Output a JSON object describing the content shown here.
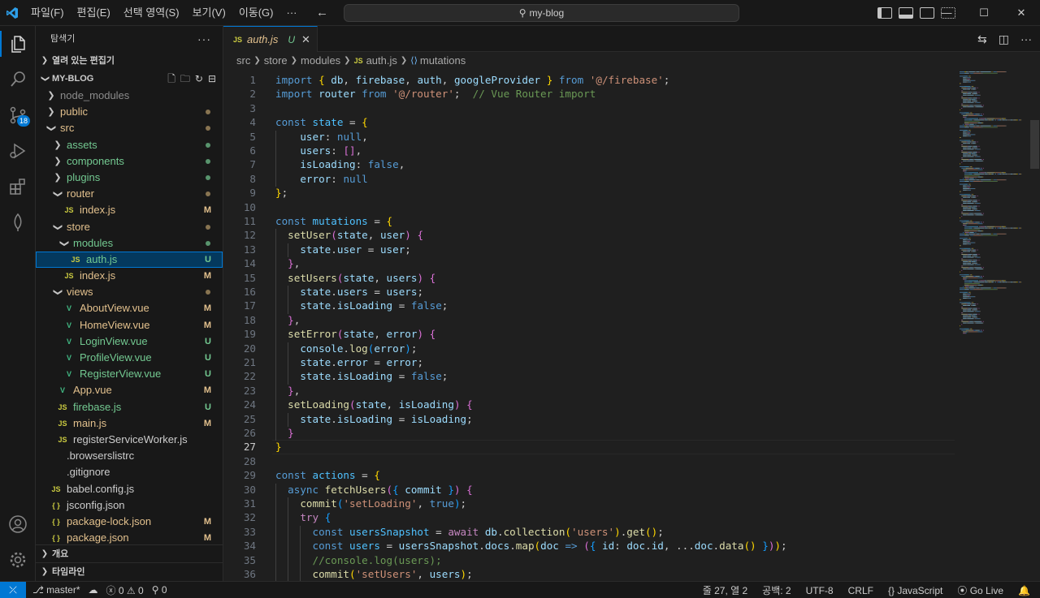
{
  "titlebar": {
    "menu": [
      "파일(F)",
      "편집(E)",
      "선택 영역(S)",
      "보기(V)",
      "이동(G)",
      "···"
    ],
    "search": "my-blog"
  },
  "activity": {
    "scm_badge": "18"
  },
  "sidebar": {
    "title": "탐색기",
    "open_editors": "열려 있는 편집기",
    "project": "MY-BLOG",
    "outline": "개요",
    "timeline": "타임라인",
    "tree": [
      {
        "label": "node_modules",
        "kind": "folder",
        "depth": 1,
        "open": false,
        "color": "ign",
        "status": ""
      },
      {
        "label": "public",
        "kind": "folder",
        "depth": 1,
        "open": false,
        "color": "mod",
        "status": "dot"
      },
      {
        "label": "src",
        "kind": "folder",
        "depth": 1,
        "open": true,
        "color": "mod",
        "status": "dot"
      },
      {
        "label": "assets",
        "kind": "folder",
        "depth": 2,
        "open": false,
        "color": "untr",
        "status": "dot"
      },
      {
        "label": "components",
        "kind": "folder",
        "depth": 2,
        "open": false,
        "color": "untr",
        "status": "dot"
      },
      {
        "label": "plugins",
        "kind": "folder",
        "depth": 2,
        "open": false,
        "color": "untr",
        "status": "dot"
      },
      {
        "label": "router",
        "kind": "folder",
        "depth": 2,
        "open": true,
        "color": "mod",
        "status": "dot"
      },
      {
        "label": "index.js",
        "kind": "js",
        "depth": 3,
        "color": "mod",
        "status": "M"
      },
      {
        "label": "store",
        "kind": "folder",
        "depth": 2,
        "open": true,
        "color": "mod",
        "status": "dot"
      },
      {
        "label": "modules",
        "kind": "folder",
        "depth": 3,
        "open": true,
        "color": "untr",
        "status": "dot"
      },
      {
        "label": "auth.js",
        "kind": "js",
        "depth": 4,
        "color": "untr",
        "status": "U",
        "selected": true
      },
      {
        "label": "index.js",
        "kind": "js",
        "depth": 3,
        "color": "mod",
        "status": "M"
      },
      {
        "label": "views",
        "kind": "folder",
        "depth": 2,
        "open": true,
        "color": "mod",
        "status": "dot"
      },
      {
        "label": "AboutView.vue",
        "kind": "vue",
        "depth": 3,
        "color": "mod",
        "status": "M"
      },
      {
        "label": "HomeView.vue",
        "kind": "vue",
        "depth": 3,
        "color": "mod",
        "status": "M"
      },
      {
        "label": "LoginView.vue",
        "kind": "vue",
        "depth": 3,
        "color": "untr",
        "status": "U"
      },
      {
        "label": "ProfileView.vue",
        "kind": "vue",
        "depth": 3,
        "color": "untr",
        "status": "U"
      },
      {
        "label": "RegisterView.vue",
        "kind": "vue",
        "depth": 3,
        "color": "untr",
        "status": "U"
      },
      {
        "label": "App.vue",
        "kind": "vue",
        "depth": 2,
        "color": "mod",
        "status": "M"
      },
      {
        "label": "firebase.js",
        "kind": "js",
        "depth": 2,
        "color": "untr",
        "status": "U"
      },
      {
        "label": "main.js",
        "kind": "js",
        "depth": 2,
        "color": "mod",
        "status": "M"
      },
      {
        "label": "registerServiceWorker.js",
        "kind": "js",
        "depth": 2,
        "color": "def",
        "status": ""
      },
      {
        "label": ".browserslistrc",
        "kind": "text",
        "depth": 1,
        "color": "def",
        "status": ""
      },
      {
        "label": ".gitignore",
        "kind": "text",
        "depth": 1,
        "color": "def",
        "status": ""
      },
      {
        "label": "babel.config.js",
        "kind": "js",
        "depth": 1,
        "color": "def",
        "status": ""
      },
      {
        "label": "jsconfig.json",
        "kind": "json",
        "depth": 1,
        "color": "def",
        "status": ""
      },
      {
        "label": "package-lock.json",
        "kind": "json",
        "depth": 1,
        "color": "mod",
        "status": "M"
      },
      {
        "label": "package.json",
        "kind": "json",
        "depth": 1,
        "color": "mod",
        "status": "M"
      }
    ]
  },
  "editor": {
    "tab": {
      "label": "auth.js",
      "status": "U",
      "icon": "JS"
    },
    "breadcrumb": [
      "src",
      "store",
      "modules",
      "auth.js",
      "mutations"
    ],
    "current_line": 27,
    "code": [
      [
        [
          "k",
          "import "
        ],
        [
          "b1",
          "{ "
        ],
        [
          "v",
          "db"
        ],
        [
          "p",
          ", "
        ],
        [
          "v",
          "firebase"
        ],
        [
          "p",
          ", "
        ],
        [
          "v",
          "auth"
        ],
        [
          "p",
          ", "
        ],
        [
          "v",
          "googleProvider"
        ],
        [
          "b1",
          " }"
        ],
        [
          "k",
          " from "
        ],
        [
          "s",
          "'@/firebase'"
        ],
        [
          "p",
          ";"
        ]
      ],
      [
        [
          "k",
          "import "
        ],
        [
          "v",
          "router"
        ],
        [
          "k",
          " from "
        ],
        [
          "s",
          "'@/router'"
        ],
        [
          "p",
          ";  "
        ],
        [
          "c",
          "// Vue Router import"
        ]
      ],
      [],
      [
        [
          "k",
          "const "
        ],
        [
          "cn",
          "state"
        ],
        [
          "p",
          " = "
        ],
        [
          "b1",
          "{"
        ]
      ],
      [
        [
          "p",
          "    "
        ],
        [
          "v",
          "user"
        ],
        [
          "p",
          ": "
        ],
        [
          "k",
          "null"
        ],
        [
          "p",
          ","
        ]
      ],
      [
        [
          "p",
          "    "
        ],
        [
          "v",
          "users"
        ],
        [
          "p",
          ": "
        ],
        [
          "b2",
          "[]"
        ],
        [
          "p",
          ","
        ]
      ],
      [
        [
          "p",
          "    "
        ],
        [
          "v",
          "isLoading"
        ],
        [
          "p",
          ": "
        ],
        [
          "k",
          "false"
        ],
        [
          "p",
          ","
        ]
      ],
      [
        [
          "p",
          "    "
        ],
        [
          "v",
          "error"
        ],
        [
          "p",
          ": "
        ],
        [
          "k",
          "null"
        ]
      ],
      [
        [
          "b1",
          "}"
        ],
        [
          "p",
          ";"
        ]
      ],
      [],
      [
        [
          "k",
          "const "
        ],
        [
          "cn",
          "mutations"
        ],
        [
          "p",
          " = "
        ],
        [
          "b1",
          "{"
        ]
      ],
      [
        [
          "p",
          "  "
        ],
        [
          "f",
          "setUser"
        ],
        [
          "b2",
          "("
        ],
        [
          "v",
          "state"
        ],
        [
          "p",
          ", "
        ],
        [
          "v",
          "user"
        ],
        [
          "b2",
          ")"
        ],
        [
          "p",
          " "
        ],
        [
          "b2",
          "{"
        ]
      ],
      [
        [
          "p",
          "    "
        ],
        [
          "v",
          "state"
        ],
        [
          "p",
          "."
        ],
        [
          "v",
          "user"
        ],
        [
          "p",
          " = "
        ],
        [
          "v",
          "user"
        ],
        [
          "p",
          ";"
        ]
      ],
      [
        [
          "p",
          "  "
        ],
        [
          "b2",
          "}"
        ],
        [
          "p",
          ","
        ]
      ],
      [
        [
          "p",
          "  "
        ],
        [
          "f",
          "setUsers"
        ],
        [
          "b2",
          "("
        ],
        [
          "v",
          "state"
        ],
        [
          "p",
          ", "
        ],
        [
          "v",
          "users"
        ],
        [
          "b2",
          ")"
        ],
        [
          "p",
          " "
        ],
        [
          "b2",
          "{"
        ]
      ],
      [
        [
          "p",
          "    "
        ],
        [
          "v",
          "state"
        ],
        [
          "p",
          "."
        ],
        [
          "v",
          "users"
        ],
        [
          "p",
          " = "
        ],
        [
          "v",
          "users"
        ],
        [
          "p",
          ";"
        ]
      ],
      [
        [
          "p",
          "    "
        ],
        [
          "v",
          "state"
        ],
        [
          "p",
          "."
        ],
        [
          "v",
          "isLoading"
        ],
        [
          "p",
          " = "
        ],
        [
          "k",
          "false"
        ],
        [
          "p",
          ";"
        ]
      ],
      [
        [
          "p",
          "  "
        ],
        [
          "b2",
          "}"
        ],
        [
          "p",
          ","
        ]
      ],
      [
        [
          "p",
          "  "
        ],
        [
          "f",
          "setError"
        ],
        [
          "b2",
          "("
        ],
        [
          "v",
          "state"
        ],
        [
          "p",
          ", "
        ],
        [
          "v",
          "error"
        ],
        [
          "b2",
          ")"
        ],
        [
          "p",
          " "
        ],
        [
          "b2",
          "{"
        ]
      ],
      [
        [
          "p",
          "    "
        ],
        [
          "v",
          "console"
        ],
        [
          "p",
          "."
        ],
        [
          "f",
          "log"
        ],
        [
          "b3",
          "("
        ],
        [
          "v",
          "error"
        ],
        [
          "b3",
          ")"
        ],
        [
          "p",
          ";"
        ]
      ],
      [
        [
          "p",
          "    "
        ],
        [
          "v",
          "state"
        ],
        [
          "p",
          "."
        ],
        [
          "v",
          "error"
        ],
        [
          "p",
          " = "
        ],
        [
          "v",
          "error"
        ],
        [
          "p",
          ";"
        ]
      ],
      [
        [
          "p",
          "    "
        ],
        [
          "v",
          "state"
        ],
        [
          "p",
          "."
        ],
        [
          "v",
          "isLoading"
        ],
        [
          "p",
          " = "
        ],
        [
          "k",
          "false"
        ],
        [
          "p",
          ";"
        ]
      ],
      [
        [
          "p",
          "  "
        ],
        [
          "b2",
          "}"
        ],
        [
          "p",
          ","
        ]
      ],
      [
        [
          "p",
          "  "
        ],
        [
          "f",
          "setLoading"
        ],
        [
          "b2",
          "("
        ],
        [
          "v",
          "state"
        ],
        [
          "p",
          ", "
        ],
        [
          "v",
          "isLoading"
        ],
        [
          "b2",
          ")"
        ],
        [
          "p",
          " "
        ],
        [
          "b2",
          "{"
        ]
      ],
      [
        [
          "p",
          "    "
        ],
        [
          "v",
          "state"
        ],
        [
          "p",
          "."
        ],
        [
          "v",
          "isLoading"
        ],
        [
          "p",
          " = "
        ],
        [
          "v",
          "isLoading"
        ],
        [
          "p",
          ";"
        ]
      ],
      [
        [
          "p",
          "  "
        ],
        [
          "b2",
          "}"
        ]
      ],
      [
        [
          "b1",
          "}"
        ]
      ],
      [],
      [
        [
          "k",
          "const "
        ],
        [
          "cn",
          "actions"
        ],
        [
          "p",
          " = "
        ],
        [
          "b1",
          "{"
        ]
      ],
      [
        [
          "p",
          "  "
        ],
        [
          "k",
          "async "
        ],
        [
          "f",
          "fetchUsers"
        ],
        [
          "b2",
          "("
        ],
        [
          "b3",
          "{ "
        ],
        [
          "v",
          "commit"
        ],
        [
          "b3",
          " }"
        ],
        [
          "b2",
          ")"
        ],
        [
          "p",
          " "
        ],
        [
          "b2",
          "{"
        ]
      ],
      [
        [
          "p",
          "    "
        ],
        [
          "f",
          "commit"
        ],
        [
          "b3",
          "("
        ],
        [
          "s",
          "'setLoading'"
        ],
        [
          "p",
          ", "
        ],
        [
          "k",
          "true"
        ],
        [
          "b3",
          ")"
        ],
        [
          "p",
          ";"
        ]
      ],
      [
        [
          "p",
          "    "
        ],
        [
          "kc",
          "try "
        ],
        [
          "b3",
          "{"
        ]
      ],
      [
        [
          "p",
          "      "
        ],
        [
          "k",
          "const "
        ],
        [
          "cn",
          "usersSnapshot"
        ],
        [
          "p",
          " = "
        ],
        [
          "kc",
          "await "
        ],
        [
          "v",
          "db"
        ],
        [
          "p",
          "."
        ],
        [
          "f",
          "collection"
        ],
        [
          "b1",
          "("
        ],
        [
          "s",
          "'users'"
        ],
        [
          "b1",
          ")"
        ],
        [
          "p",
          "."
        ],
        [
          "f",
          "get"
        ],
        [
          "b1",
          "()"
        ],
        [
          "p",
          ";"
        ]
      ],
      [
        [
          "p",
          "      "
        ],
        [
          "k",
          "const "
        ],
        [
          "cn",
          "users"
        ],
        [
          "p",
          " = "
        ],
        [
          "v",
          "usersSnapshot"
        ],
        [
          "p",
          "."
        ],
        [
          "v",
          "docs"
        ],
        [
          "p",
          "."
        ],
        [
          "f",
          "map"
        ],
        [
          "b1",
          "("
        ],
        [
          "v",
          "doc"
        ],
        [
          "p",
          " "
        ],
        [
          "k",
          "=>"
        ],
        [
          "p",
          " "
        ],
        [
          "b2",
          "("
        ],
        [
          "b3",
          "{ "
        ],
        [
          "v",
          "id"
        ],
        [
          "p",
          ": "
        ],
        [
          "v",
          "doc"
        ],
        [
          "p",
          "."
        ],
        [
          "v",
          "id"
        ],
        [
          "p",
          ", ..."
        ],
        [
          "v",
          "doc"
        ],
        [
          "p",
          "."
        ],
        [
          "f",
          "data"
        ],
        [
          "b1",
          "()"
        ],
        [
          "b3",
          " }"
        ],
        [
          "b2",
          ")"
        ],
        [
          "b1",
          ")"
        ],
        [
          "p",
          ";"
        ]
      ],
      [
        [
          "p",
          "      "
        ],
        [
          "c",
          "//console.log(users);"
        ]
      ],
      [
        [
          "p",
          "      "
        ],
        [
          "f",
          "commit"
        ],
        [
          "b1",
          "("
        ],
        [
          "s",
          "'setUsers'"
        ],
        [
          "p",
          ", "
        ],
        [
          "v",
          "users"
        ],
        [
          "b1",
          ")"
        ],
        [
          "p",
          ";"
        ]
      ],
      [
        [
          "p",
          "    "
        ],
        [
          "b3",
          "}"
        ],
        [
          "p",
          " "
        ],
        [
          "kc",
          "catch "
        ],
        [
          "b3",
          "("
        ],
        [
          "v",
          "error"
        ],
        [
          "b3",
          ")"
        ],
        [
          "p",
          " "
        ],
        [
          "b3",
          "{"
        ]
      ]
    ]
  },
  "status": {
    "branch": "master*",
    "errors": "0",
    "warnings": "0",
    "ports": "0",
    "position": "줄 27, 열 2",
    "spaces": "공백: 2",
    "encoding": "UTF-8",
    "eol": "CRLF",
    "language": "JavaScript",
    "golive": "Go Live"
  }
}
